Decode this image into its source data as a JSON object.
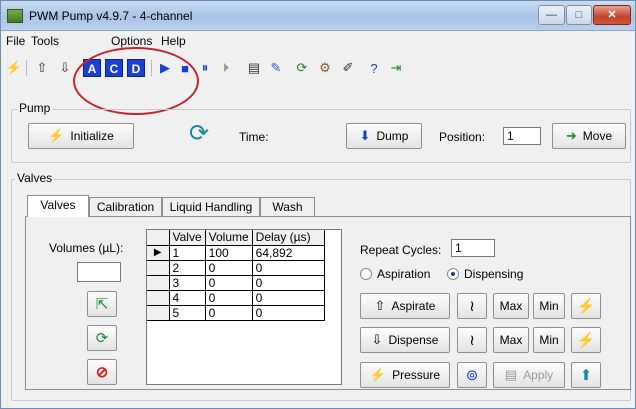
{
  "window": {
    "title": "PWM Pump v4.9.7 - 4-channel",
    "minimize": "—",
    "maximize": "□",
    "close": "✕"
  },
  "menu": [
    "File",
    "Tools",
    "Options",
    "Help"
  ],
  "toolbar": {
    "channel_buttons": [
      "A",
      "C",
      "D"
    ]
  },
  "pump": {
    "group_label": "Pump",
    "initialize_label": "Initialize",
    "time_label": "Time:",
    "dump_label": "Dump",
    "position_label": "Position:",
    "position_value": "1",
    "move_label": "Move"
  },
  "valves": {
    "group_label": "Valves",
    "tabs": [
      "Valves",
      "Calibration",
      "Liquid Handling",
      "Wash"
    ],
    "volumes_label": "Volumes (µL):",
    "volumes_value": "",
    "table": {
      "columns": [
        "Valve",
        "Volume",
        "Delay (µs)"
      ],
      "rows": [
        [
          "1",
          "100",
          "64,892"
        ],
        [
          "2",
          "0",
          "0"
        ],
        [
          "3",
          "0",
          "0"
        ],
        [
          "4",
          "0",
          "0"
        ],
        [
          "5",
          "0",
          "0"
        ]
      ]
    },
    "repeat_label": "Repeat Cycles:",
    "repeat_value": "1",
    "aspiration_label": "Aspiration",
    "dispensing_label": "Dispensing",
    "mode_selected": "Dispensing",
    "aspirate_label": "Aspirate",
    "dispense_label": "Dispense",
    "pressure_label": "Pressure",
    "max_label": "Max",
    "min_label": "Min",
    "apply_label": "Apply"
  },
  "colors": {
    "annotation": "#c3252b",
    "channel_button": "#1a3fd1"
  }
}
